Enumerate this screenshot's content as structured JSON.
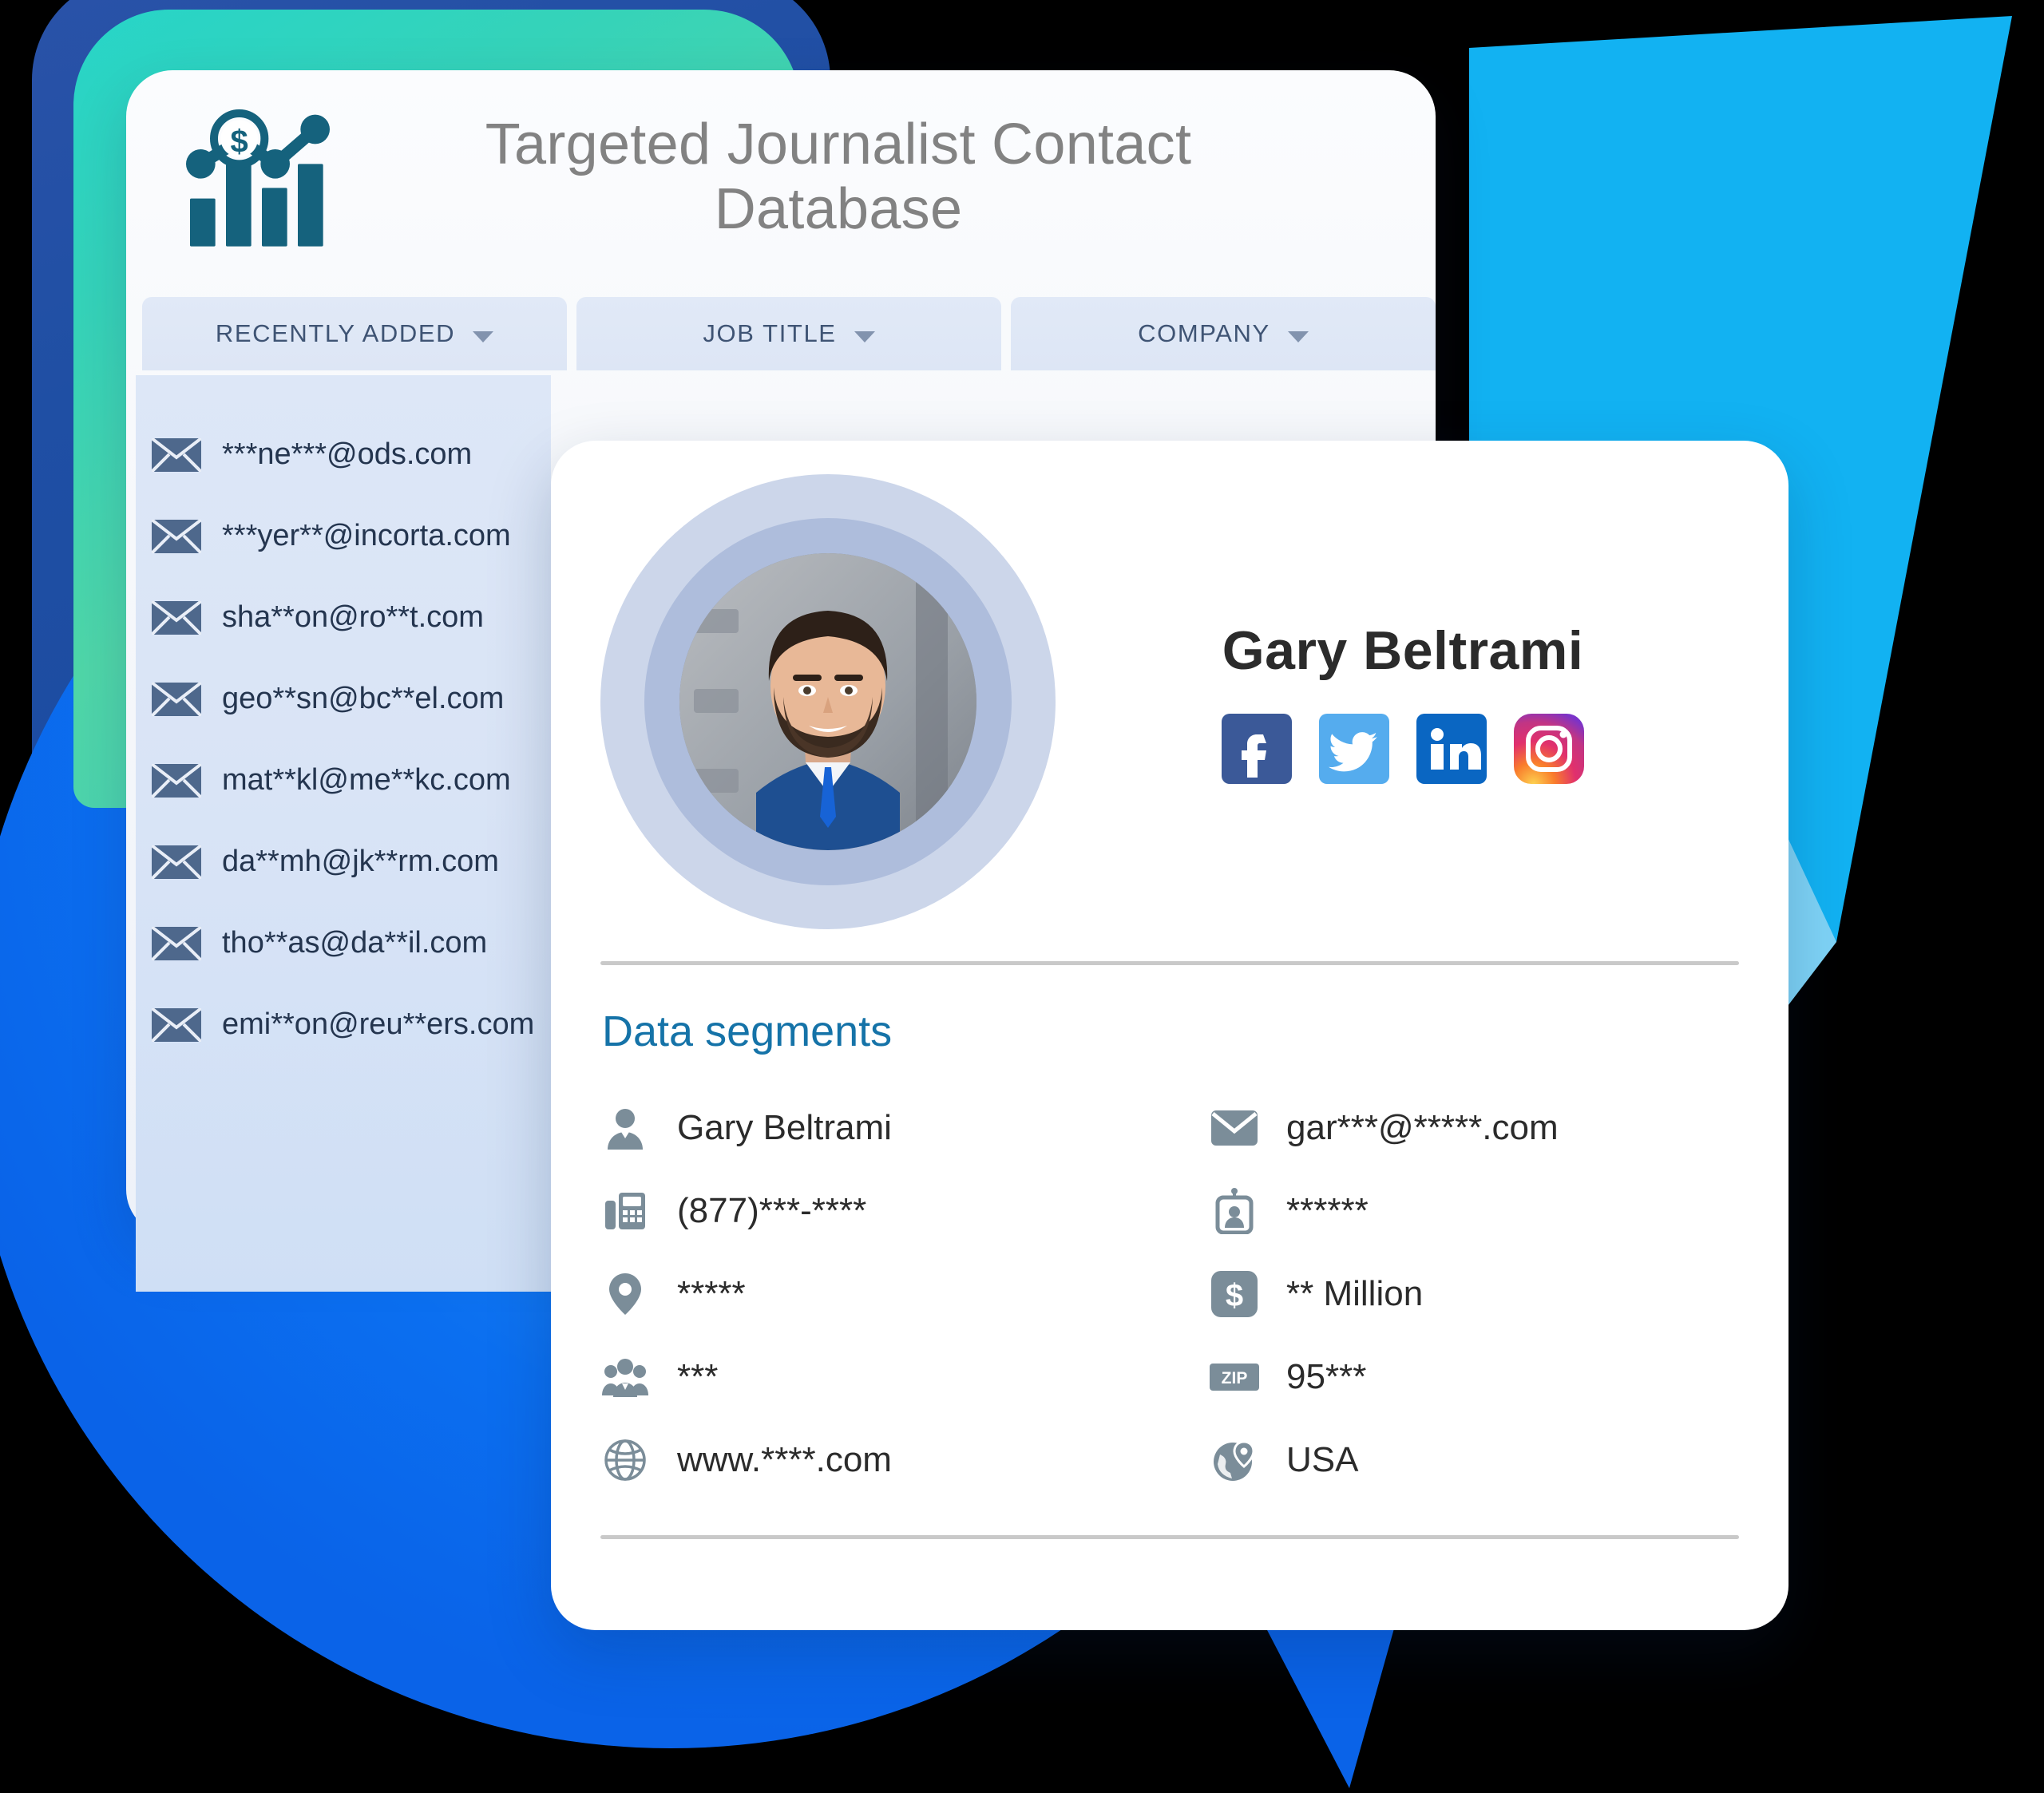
{
  "app": {
    "title": "Targeted Journalist Contact Database",
    "logo_icon": "bar-chart-dollar-icon"
  },
  "filters": [
    {
      "label": "RECENTLY ADDED",
      "icon": "chevron-down-icon"
    },
    {
      "label": "JOB TITLE",
      "icon": "chevron-down-icon"
    },
    {
      "label": "COMPANY",
      "icon": "chevron-down-icon"
    }
  ],
  "recently_added": {
    "row_icon": "envelope-icon",
    "emails": [
      "***ne***@ods.com",
      "***yer**@incorta.com",
      "sha**on@ro**t.com",
      "geo**sn@bc**el.com",
      "mat**kl@me**kc.com",
      "da**mh@jk**rm.com",
      "tho**as@da**il.com",
      "emi**on@reu**ers.com"
    ]
  },
  "contact": {
    "avatar_icon": "person-photo-avatar",
    "name": "Gary Beltrami",
    "socials": [
      {
        "name": "facebook-icon",
        "color": "#3b5998"
      },
      {
        "name": "twitter-icon",
        "color": "#55acee"
      },
      {
        "name": "linkedin-icon",
        "color": "#0a66c2"
      },
      {
        "name": "instagram-icon",
        "color": "#e1306c"
      }
    ],
    "segments_heading": "Data segments",
    "segments_left": [
      {
        "icon": "person-icon",
        "value": "Gary Beltrami"
      },
      {
        "icon": "fax-phone-icon",
        "value": "(877)***-****"
      },
      {
        "icon": "location-pin-icon",
        "value": "*****"
      },
      {
        "icon": "people-group-icon",
        "value": "***"
      },
      {
        "icon": "globe-icon",
        "value": "www.****.com"
      }
    ],
    "segments_right": [
      {
        "icon": "envelope-icon",
        "value": "gar***@*****.com"
      },
      {
        "icon": "id-badge-icon",
        "value": "******"
      },
      {
        "icon": "dollar-icon",
        "value": "** Million"
      },
      {
        "icon": "zip-icon",
        "value": "95***"
      },
      {
        "icon": "globe-pin-icon",
        "value": "USA"
      }
    ]
  },
  "theme": {
    "accent_blue": "#0a63e8",
    "sky_blue": "#12b2f2",
    "teal": "#35d3b9",
    "navy": "#1f4fa4",
    "heading_grey": "#828282",
    "segment_blue": "#1573a8",
    "tab_bg": "#dde6f5",
    "list_bg": "#d9e4f6"
  }
}
